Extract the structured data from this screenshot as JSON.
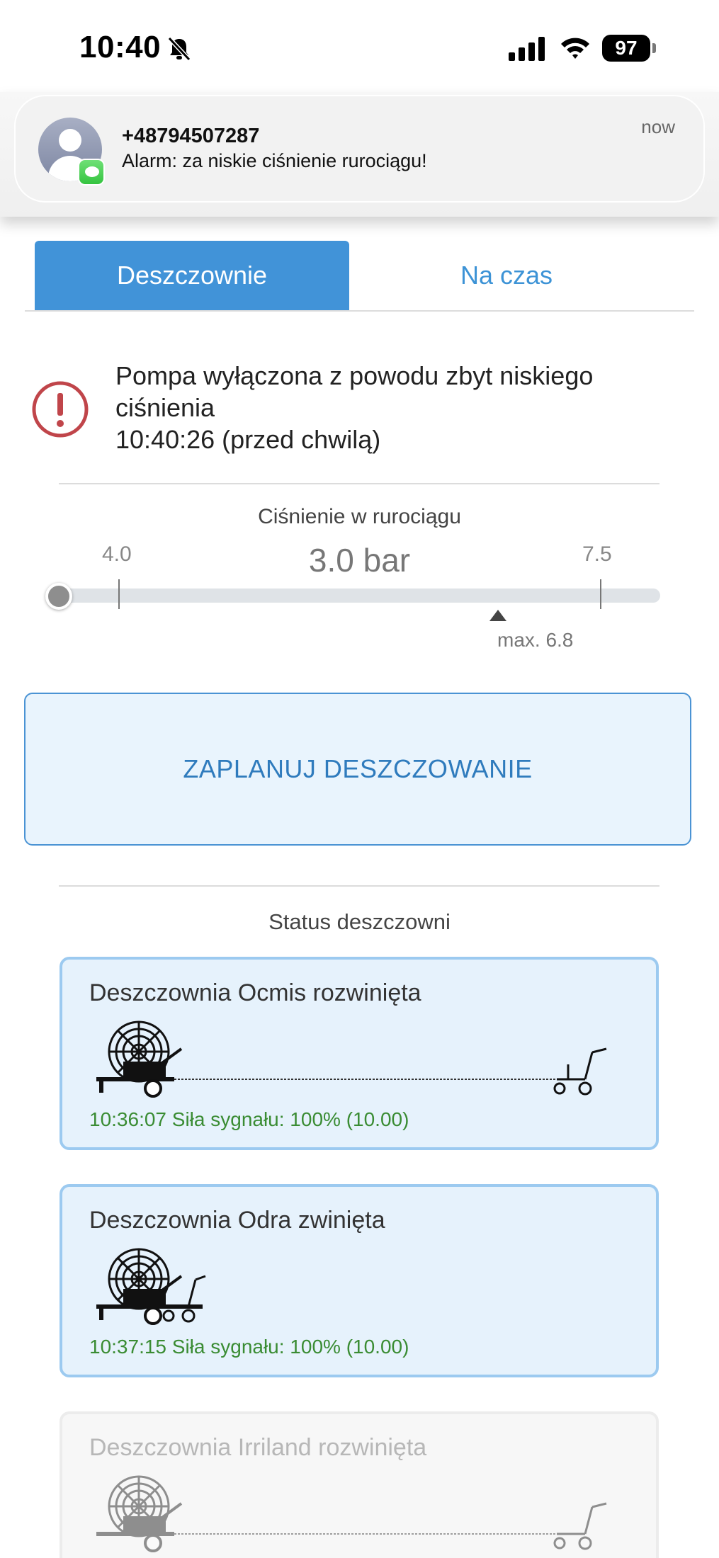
{
  "status_bar": {
    "time": "10:40",
    "battery": "97"
  },
  "notification": {
    "sender": "+48794507287",
    "message": "Alarm: za niskie ciśnienie rurociągu!",
    "time": "now"
  },
  "tabs": [
    {
      "label": "Deszczownie",
      "active": true
    },
    {
      "label": "Na czas",
      "active": false
    }
  ],
  "alert": {
    "line1": "Pompa wyłączona z powodu zbyt niskiego",
    "line2": "ciśnienia",
    "line3": "10:40:26 (przed chwilą)"
  },
  "pressure": {
    "label": "Ciśnienie w rurociągu",
    "min": "4.0",
    "value": "3.0 bar",
    "max": "7.5",
    "limit_label": "max. 6.8"
  },
  "plan_button": {
    "label": "ZAPLANUJ DESZCZOWANIE"
  },
  "status": {
    "title": "Status deszczowni",
    "cards": [
      {
        "title": "Deszczownia Ocmis rozwinięta",
        "status": "10:36:07 Siła sygnału: 100% (10.00)",
        "state": "extended"
      },
      {
        "title": "Deszczownia Odra zwinięta",
        "status": "10:37:15 Siła sygnału: 100% (10.00)",
        "state": "retracted"
      },
      {
        "title": "Deszczownia Irriland rozwinięta",
        "state": "extended",
        "disabled": true
      }
    ]
  },
  "colors": {
    "accent": "#4193d8",
    "status_green": "#3a8c33",
    "alert_red": "#c0454a"
  }
}
